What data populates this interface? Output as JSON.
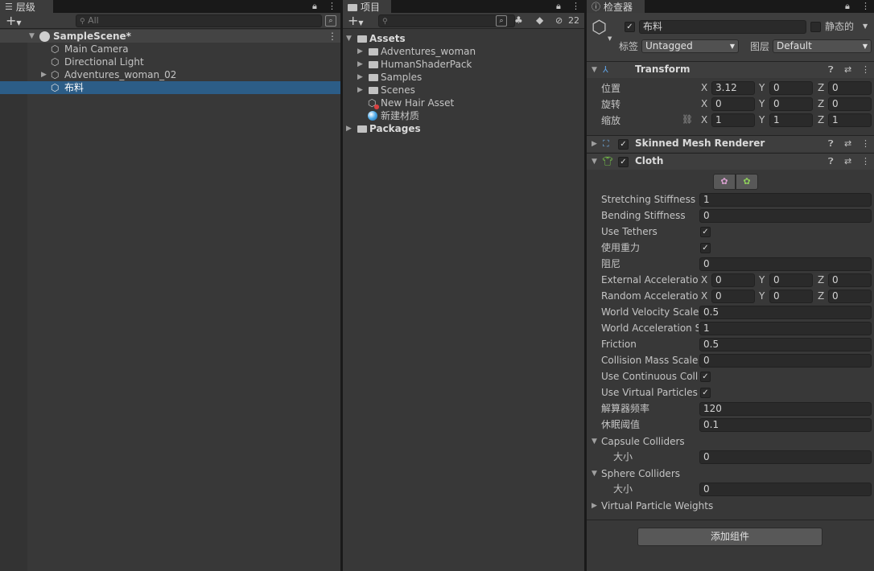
{
  "hierarchy": {
    "tab_label": "层级",
    "search_placeholder": "All",
    "scene_name": "SampleScene*",
    "items": [
      "Main Camera",
      "Directional Light",
      "Adventures_woman_02",
      "布料"
    ]
  },
  "project": {
    "tab_label": "项目",
    "hidden_count": "22",
    "root": "Assets",
    "folders": [
      "Adventures_woman",
      "HumanShaderPack",
      "Samples",
      "Scenes"
    ],
    "assets": [
      "New Hair Asset",
      "新建材质"
    ],
    "packages": "Packages"
  },
  "inspector": {
    "tab_label": "检查器",
    "object_name": "布料",
    "static_label": "静态的",
    "tag_label": "标签",
    "tag_value": "Untagged",
    "layer_label": "图层",
    "layer_value": "Default",
    "transform": {
      "title": "Transform",
      "position_label": "位置",
      "rotation_label": "旋转",
      "scale_label": "缩放",
      "position": {
        "x": "3.12",
        "y": "0",
        "z": "0"
      },
      "rotation": {
        "x": "0",
        "y": "0",
        "z": "0"
      },
      "scale": {
        "x": "1",
        "y": "1",
        "z": "1"
      }
    },
    "skinned_mesh_renderer": {
      "title": "Skinned Mesh Renderer"
    },
    "cloth": {
      "title": "Cloth",
      "stretching_stiffness_label": "Stretching Stiffness",
      "stretching_stiffness": "1",
      "bending_stiffness_label": "Bending Stiffness",
      "bending_stiffness": "0",
      "use_tethers_label": "Use Tethers",
      "use_gravity_label": "使用重力",
      "damping_label": "阻尼",
      "damping": "0",
      "external_accel_label": "External Acceleration",
      "external_accel": {
        "x": "0",
        "y": "0",
        "z": "0"
      },
      "random_accel_label": "Random Acceleration",
      "random_accel": {
        "x": "0",
        "y": "0",
        "z": "0"
      },
      "world_velocity_scale_label": "World Velocity Scale",
      "world_velocity_scale": "0.5",
      "world_accel_scale_label": "World Acceleration Scale",
      "world_accel_scale": "1",
      "friction_label": "Friction",
      "friction": "0.5",
      "collision_mass_scale_label": "Collision Mass Scale",
      "collision_mass_scale": "0",
      "use_continuous_label": "Use Continuous Collision",
      "use_virtual_particles_label": "Use Virtual Particles",
      "solver_frequency_label": "解算器频率",
      "solver_frequency": "120",
      "sleep_threshold_label": "休眠阈值",
      "sleep_threshold": "0.1",
      "capsule_colliders_label": "Capsule Colliders",
      "size_label": "大小",
      "capsule_size": "0",
      "sphere_colliders_label": "Sphere Colliders",
      "sphere_size": "0",
      "virtual_particle_weights_label": "Virtual Particle Weights"
    },
    "add_component_label": "添加组件"
  },
  "axis": {
    "x": "X",
    "y": "Y",
    "z": "Z"
  },
  "colors": {
    "selection": "#2c5d87",
    "panel_bg": "#383838",
    "toolbar_bg": "#3c3c3c"
  }
}
